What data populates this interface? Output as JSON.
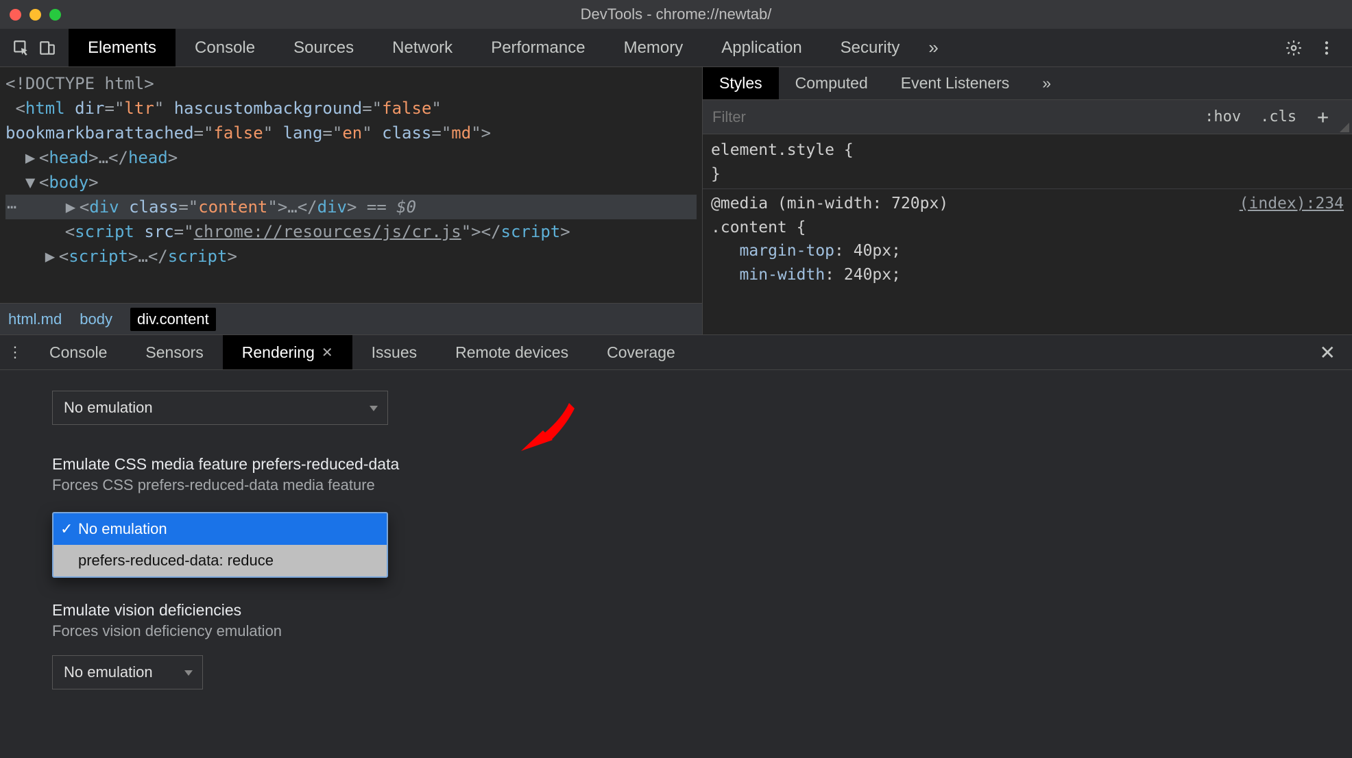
{
  "window": {
    "title": "DevTools - chrome://newtab/"
  },
  "main_tabs": {
    "items": [
      "Elements",
      "Console",
      "Sources",
      "Network",
      "Performance",
      "Memory",
      "Application",
      "Security"
    ],
    "active_index": 0,
    "overflow_glyph": "»"
  },
  "dom": {
    "doctype": "<!DOCTYPE html>",
    "html_open_1": "<html dir=\"ltr\" hascustombackground=\"false\"",
    "html_open_2": "bookmarkbarattached=\"false\" lang=\"en\" class=\"md\">",
    "head": "<head>…</head>",
    "body_open": "<body>",
    "selected_line": "<div class=\"content\">…</div>",
    "selected_eq": " == $0",
    "script1": "<script src=\"chrome://resources/js/cr.js\"></script>",
    "script2": "<script>…</script>"
  },
  "breadcrumb": {
    "items": [
      "html.md",
      "body",
      "div.content"
    ],
    "current_index": 2
  },
  "styles_pane": {
    "tabs": [
      "Styles",
      "Computed",
      "Event Listeners"
    ],
    "active_index": 0,
    "overflow_glyph": "»",
    "filter_placeholder": "Filter",
    "hov_label": ":hov",
    "cls_label": ".cls",
    "plus_label": "+",
    "element_style": "element.style {",
    "close_brace": "}",
    "media_line": "@media (min-width: 720px)",
    "rule_selector": ".content {",
    "rule_source": "(index):234",
    "decl_1_prop": "margin-top",
    "decl_1_val": "40px",
    "decl_2_prop": "min-width",
    "decl_2_val": "240px"
  },
  "drawer": {
    "tabs": [
      "Console",
      "Sensors",
      "Rendering",
      "Issues",
      "Remote devices",
      "Coverage"
    ],
    "active_index": 2
  },
  "rendering": {
    "select1_value": "No emulation",
    "prefers_reduced_data": {
      "title": "Emulate CSS media feature prefers-reduced-data",
      "subtitle": "Forces CSS prefers-reduced-data media feature",
      "options": [
        "No emulation",
        "prefers-reduced-data: reduce"
      ],
      "selected_index": 0
    },
    "vision": {
      "title": "Emulate vision deficiencies",
      "subtitle": "Forces vision deficiency emulation",
      "value": "No emulation"
    }
  }
}
